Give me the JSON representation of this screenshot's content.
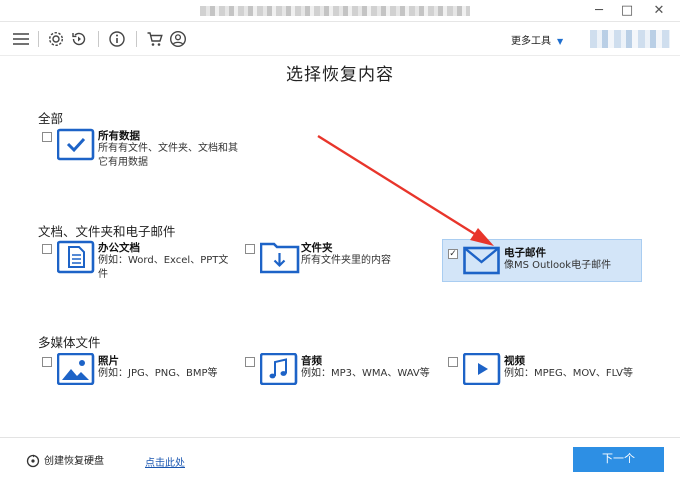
{
  "window": {
    "minimize": "─",
    "maximize": "□",
    "close": "✕"
  },
  "toolbar": {
    "icons": [
      "menu-icon",
      "gear-icon",
      "history-icon",
      "info-icon",
      "cart-icon",
      "account-icon"
    ],
    "more_tools_label": "更多工具",
    "more_tools_caret": "▼"
  },
  "page_title": "选择恢复内容",
  "sections": {
    "all": {
      "label": "全部",
      "items": [
        {
          "name": "所有数据",
          "desc": "所有有文件、文件夹、文档和其它有用数据",
          "checked": false,
          "icon": "checkmark-icon"
        }
      ]
    },
    "documents": {
      "label": "文档、文件夹和电子邮件",
      "items": [
        {
          "name": "办公文档",
          "desc": "例如：Word、Excel、PPT文件",
          "checked": false,
          "icon": "document-icon"
        },
        {
          "name": "文件夹",
          "desc": "所有文件夹里的内容",
          "checked": false,
          "icon": "folder-icon"
        },
        {
          "name": "电子邮件",
          "desc": "像MS Outlook电子邮件",
          "checked": true,
          "icon": "envelope-icon"
        }
      ]
    },
    "media": {
      "label": "多媒体文件",
      "items": [
        {
          "name": "照片",
          "desc": "例如：JPG、PNG、BMP等",
          "checked": false,
          "icon": "photo-icon"
        },
        {
          "name": "音频",
          "desc": "例如：MP3、WMA、WAV等",
          "checked": false,
          "icon": "music-icon"
        },
        {
          "name": "视频",
          "desc": "例如：MPEG、MOV、FLV等",
          "checked": false,
          "icon": "video-icon"
        }
      ]
    }
  },
  "footer": {
    "create_disk_label": "创建恢复硬盘",
    "link_label": "点击此处",
    "next_label": "下一个"
  },
  "colors": {
    "accent": "#1f6fcf",
    "icon_blue": "#1d63c7",
    "selection_bg": "#d3e5f8",
    "button_blue": "#2d8fe4",
    "annotation_red": "#e8352b"
  },
  "checkbox_mark": "✓"
}
